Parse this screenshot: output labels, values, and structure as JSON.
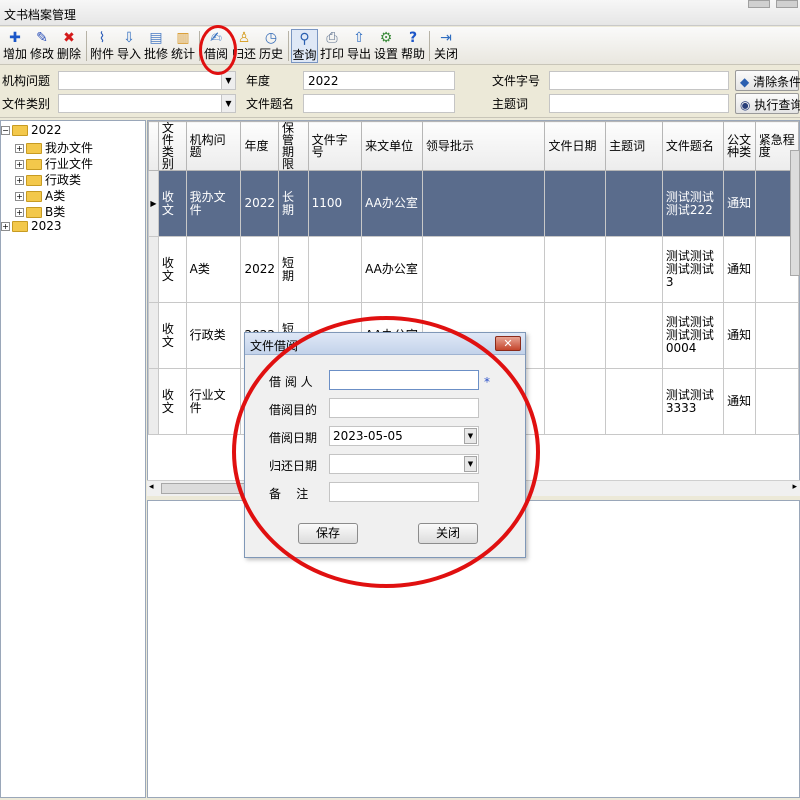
{
  "app": {
    "title": "文书档案管理"
  },
  "toolbar": {
    "buttons": [
      {
        "label": "增加",
        "icon": "plus-icon"
      },
      {
        "label": "修改",
        "icon": "pencil-icon"
      },
      {
        "label": "删除",
        "icon": "delete-x-icon"
      },
      {
        "label": "附件",
        "icon": "paperclip-icon"
      },
      {
        "label": "导入",
        "icon": "import-icon"
      },
      {
        "label": "批修",
        "icon": "batch-edit-icon"
      },
      {
        "label": "统计",
        "icon": "statistics-icon"
      },
      {
        "label": "借阅",
        "icon": "borrow-icon"
      },
      {
        "label": "归还",
        "icon": "return-icon"
      },
      {
        "label": "历史",
        "icon": "clock-icon"
      },
      {
        "label": "查询",
        "icon": "magnifier-icon"
      },
      {
        "label": "打印",
        "icon": "printer-icon"
      },
      {
        "label": "导出",
        "icon": "export-icon"
      },
      {
        "label": "设置",
        "icon": "settings-icon"
      },
      {
        "label": "帮助",
        "icon": "help-icon"
      },
      {
        "label": "关闭",
        "icon": "exit-icon"
      }
    ]
  },
  "filters": {
    "org_label": "机构问题",
    "org_value": "",
    "year_label": "年度",
    "year_value": "2022",
    "docnum_label": "文件字号",
    "docnum_value": "",
    "category_label": "文件类别",
    "category_value": "",
    "doctitle_label": "文件题名",
    "doctitle_value": "",
    "keyword_label": "主题词",
    "keyword_value": "",
    "clear_button": "清除条件",
    "search_button": "执行查询"
  },
  "tree": {
    "nodes": [
      {
        "label": "2022",
        "expanded": true,
        "level": 0
      },
      {
        "label": "我办文件",
        "level": 1
      },
      {
        "label": "行业文件",
        "level": 1
      },
      {
        "label": "行政类",
        "level": 1
      },
      {
        "label": "A类",
        "level": 1
      },
      {
        "label": "B类",
        "level": 1
      },
      {
        "label": "2023",
        "expanded": false,
        "level": 0
      }
    ]
  },
  "grid": {
    "columns": [
      "文件类别",
      "机构问题",
      "年度",
      "保管期限",
      "文件字号",
      "来文单位",
      "领导批示",
      "文件日期",
      "主题词",
      "文件题名",
      "公文种类",
      "紧急程度"
    ],
    "rows": [
      [
        "收文",
        "我办文件",
        "2022",
        "长期",
        "1100",
        "AA办公室",
        "",
        "",
        "",
        "测试测试测试222",
        "通知",
        ""
      ],
      [
        "收文",
        "A类",
        "2022",
        "短期",
        "",
        "AA办公室",
        "",
        "",
        "",
        "测试测试测试测试3",
        "通知",
        ""
      ],
      [
        "收文",
        "行政类",
        "2022",
        "短期",
        "",
        "AA办公室",
        "",
        "",
        "",
        "测试测试测试测试0004",
        "通知",
        ""
      ],
      [
        "收文",
        "行业文件",
        "",
        "",
        "",
        "",
        "",
        "",
        "",
        "测试测试3333",
        "通知",
        ""
      ]
    ]
  },
  "dialog": {
    "title": "文件借阅",
    "borrower_label": "借 阅 人",
    "borrower_value": "",
    "required_mark": "*",
    "purpose_label": "借阅目的",
    "purpose_value": "",
    "borrow_date_label": "借阅日期",
    "borrow_date_value": "2023-05-05",
    "return_date_label": "归还日期",
    "return_date_value": "",
    "note_label": "备    注",
    "note_value": "",
    "save_button": "保存",
    "close_button": "关闭"
  },
  "colors": {
    "selected_row": "#5a6c8c",
    "annotation": "#e01010"
  }
}
